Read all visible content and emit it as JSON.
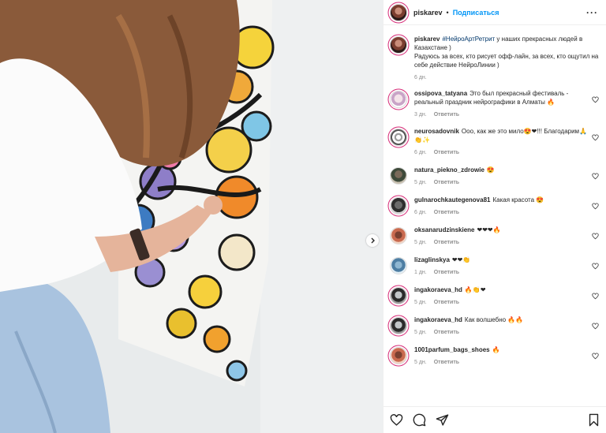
{
  "post": {
    "username": "piskarev",
    "separator": "•",
    "follow_label": "Подписаться",
    "more_label": "···"
  },
  "caption": {
    "username": "piskarev",
    "hashtag": "#НейроАртРетрит",
    "text_line1": " у наших прекрасных людей в Казахстане )",
    "text_line2": "Радуюсь за всех, кто рисует офф-лайн, за всех, кто ощутил на себе действие НейроЛинии )",
    "time": "6 дн."
  },
  "reply_label": "Ответить",
  "comments": [
    {
      "username": "ossipova_tatyana",
      "text": "Это был прекрасный фестиваль - реальный праздник нейрографики в Алматы 🔥",
      "time": "3 дн."
    },
    {
      "username": "neurosadovnik",
      "text": "Ооо, как же это мило😍❤!!! Благодарим🙏👏✨",
      "time": "6 дн."
    },
    {
      "username": "natura_piekno_zdrowie",
      "text": "😍",
      "time": "5 дн."
    },
    {
      "username": "gulnarochkautegenova81",
      "text": "Какая красота 😍",
      "time": "6 дн."
    },
    {
      "username": "oksanarudzinskiene",
      "text": "❤❤❤🔥",
      "time": "5 дн."
    },
    {
      "username": "lizaglinskya",
      "text": "❤❤👏",
      "time": "1 дн."
    },
    {
      "username": "ingakoraeva_hd",
      "text": "🔥👏❤",
      "time": "5 дн."
    },
    {
      "username": "ingakoraeva_hd",
      "text": "Как волшебно 🔥🔥",
      "time": "5 дн."
    },
    {
      "username": "1001parfum_bags_shoes",
      "text": "🔥",
      "time": "5 дн."
    }
  ],
  "icons": {
    "like": "heart-icon",
    "comment": "comment-icon",
    "share": "share-icon",
    "save": "bookmark-icon",
    "next": "chevron-right-icon"
  },
  "colors": {
    "link": "#0095f6",
    "hashtag": "#00376b",
    "muted": "#8e8e8e",
    "text": "#262626"
  }
}
